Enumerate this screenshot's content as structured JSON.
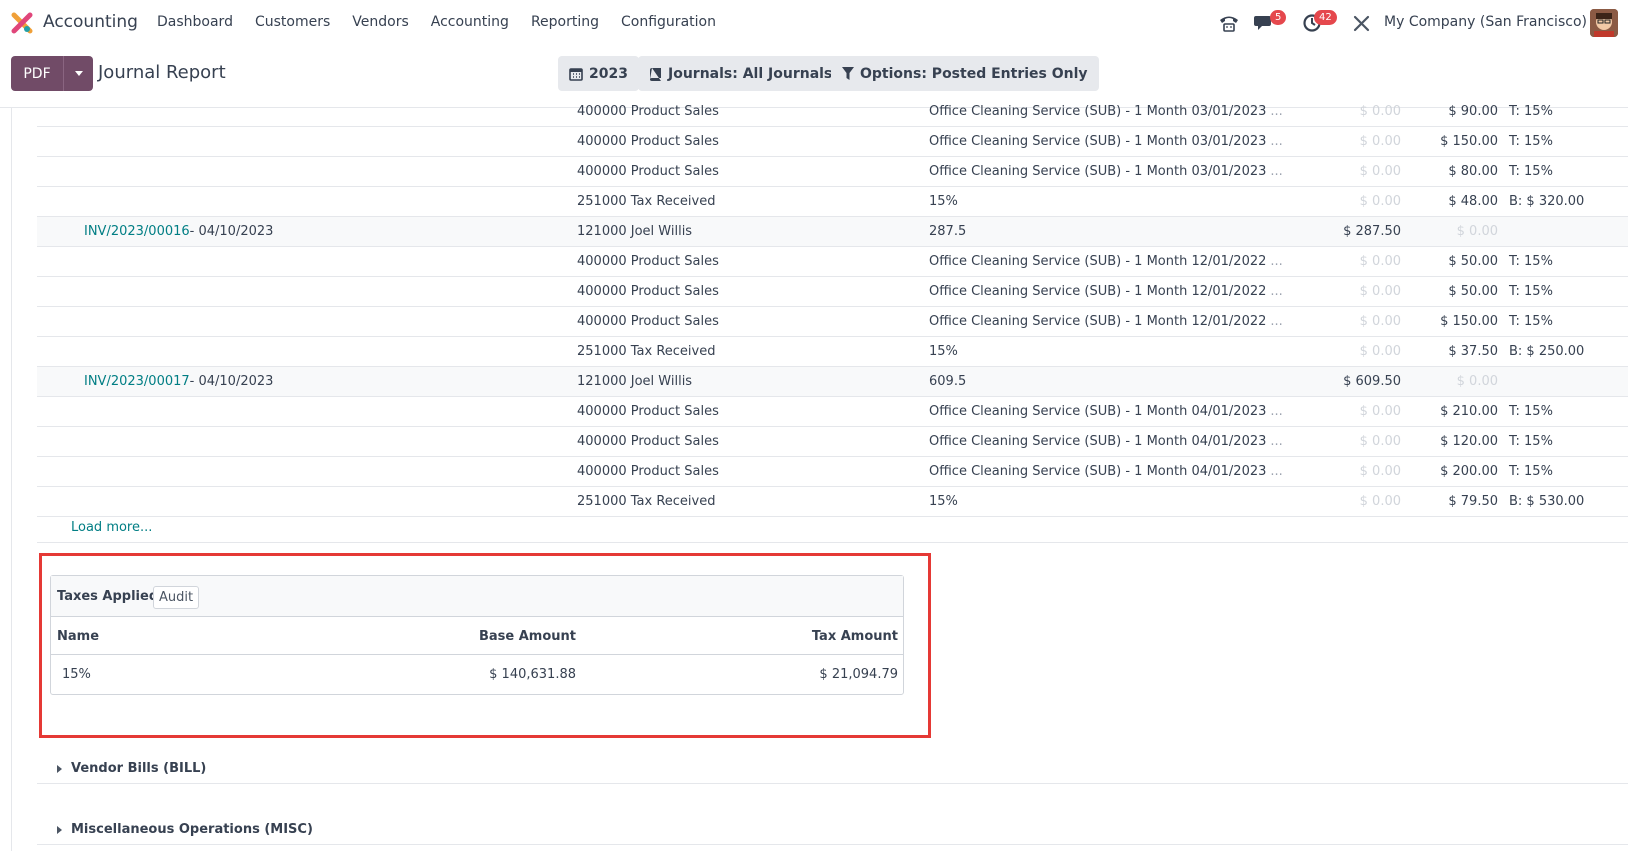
{
  "navbar": {
    "app_name": "Accounting",
    "menu": [
      "Dashboard",
      "Customers",
      "Vendors",
      "Accounting",
      "Reporting",
      "Configuration"
    ],
    "messages_badge": "5",
    "activities_badge": "42",
    "company": "My Company (San Francisco)"
  },
  "control": {
    "pdf_label": "PDF",
    "title": "Journal Report",
    "filters": [
      "2023",
      "Journals: All Journals",
      "Options: Posted Entries Only"
    ]
  },
  "rows": [
    {
      "move": "",
      "date": "",
      "account": "400000 Product Sales",
      "label": "Office Cleaning Service (SUB) - 1 Month 03/01/2023",
      "dots": "...",
      "debit": "$ 0.00",
      "credit": "$ 90.00",
      "tax": "T: 15%",
      "head": false
    },
    {
      "move": "",
      "date": "",
      "account": "400000 Product Sales",
      "label": "Office Cleaning Service (SUB) - 1 Month 03/01/2023",
      "dots": "...",
      "debit": "$ 0.00",
      "credit": "$ 150.00",
      "tax": "T: 15%",
      "head": false
    },
    {
      "move": "",
      "date": "",
      "account": "400000 Product Sales",
      "label": "Office Cleaning Service (SUB) - 1 Month 03/01/2023",
      "dots": "...",
      "debit": "$ 0.00",
      "credit": "$ 80.00",
      "tax": "T: 15%",
      "head": false
    },
    {
      "move": "",
      "date": "",
      "account": "251000 Tax Received",
      "label": "15%",
      "dots": "",
      "debit": "$ 0.00",
      "credit": "$ 48.00",
      "tax": "B: $ 320.00",
      "head": false
    },
    {
      "move": "INV/2023/00016",
      "date": "- 04/10/2023",
      "account": "121000 Joel Willis",
      "label": "287.5",
      "dots": "",
      "debit": "$ 287.50",
      "credit": "$ 0.00",
      "tax": "",
      "head": true
    },
    {
      "move": "",
      "date": "",
      "account": "400000 Product Sales",
      "label": "Office Cleaning Service (SUB) - 1 Month 12/01/2022",
      "dots": "...",
      "debit": "$ 0.00",
      "credit": "$ 50.00",
      "tax": "T: 15%",
      "head": false
    },
    {
      "move": "",
      "date": "",
      "account": "400000 Product Sales",
      "label": "Office Cleaning Service (SUB) - 1 Month 12/01/2022",
      "dots": "...",
      "debit": "$ 0.00",
      "credit": "$ 50.00",
      "tax": "T: 15%",
      "head": false
    },
    {
      "move": "",
      "date": "",
      "account": "400000 Product Sales",
      "label": "Office Cleaning Service (SUB) - 1 Month 12/01/2022",
      "dots": "...",
      "debit": "$ 0.00",
      "credit": "$ 150.00",
      "tax": "T: 15%",
      "head": false
    },
    {
      "move": "",
      "date": "",
      "account": "251000 Tax Received",
      "label": "15%",
      "dots": "",
      "debit": "$ 0.00",
      "credit": "$ 37.50",
      "tax": "B: $ 250.00",
      "head": false
    },
    {
      "move": "INV/2023/00017",
      "date": "- 04/10/2023",
      "account": "121000 Joel Willis",
      "label": "609.5",
      "dots": "",
      "debit": "$ 609.50",
      "credit": "$ 0.00",
      "tax": "",
      "head": true
    },
    {
      "move": "",
      "date": "",
      "account": "400000 Product Sales",
      "label": "Office Cleaning Service (SUB) - 1 Month 04/01/2023",
      "dots": "...",
      "debit": "$ 0.00",
      "credit": "$ 210.00",
      "tax": "T: 15%",
      "head": false
    },
    {
      "move": "",
      "date": "",
      "account": "400000 Product Sales",
      "label": "Office Cleaning Service (SUB) - 1 Month 04/01/2023",
      "dots": "...",
      "debit": "$ 0.00",
      "credit": "$ 120.00",
      "tax": "T: 15%",
      "head": false
    },
    {
      "move": "",
      "date": "",
      "account": "400000 Product Sales",
      "label": "Office Cleaning Service (SUB) - 1 Month 04/01/2023",
      "dots": "...",
      "debit": "$ 0.00",
      "credit": "$ 200.00",
      "tax": "T: 15%",
      "head": false
    },
    {
      "move": "",
      "date": "",
      "account": "251000 Tax Received",
      "label": "15%",
      "dots": "",
      "debit": "$ 0.00",
      "credit": "$ 79.50",
      "tax": "B: $ 530.00",
      "head": false
    }
  ],
  "load_more": "Load more...",
  "taxes": {
    "title": "Taxes Applied",
    "audit": "Audit",
    "columns": [
      "Name",
      "Base Amount",
      "Tax Amount"
    ],
    "rows": [
      {
        "name": "15%",
        "base": "$ 140,631.88",
        "tax": "$ 21,094.79"
      }
    ]
  },
  "sections": [
    "Vendor Bills (BILL)",
    "Miscellaneous Operations (MISC)"
  ],
  "colors": {
    "brand": "#714b67",
    "link": "#017e84",
    "highlight": "#e53935",
    "badge": "#e5484d"
  }
}
